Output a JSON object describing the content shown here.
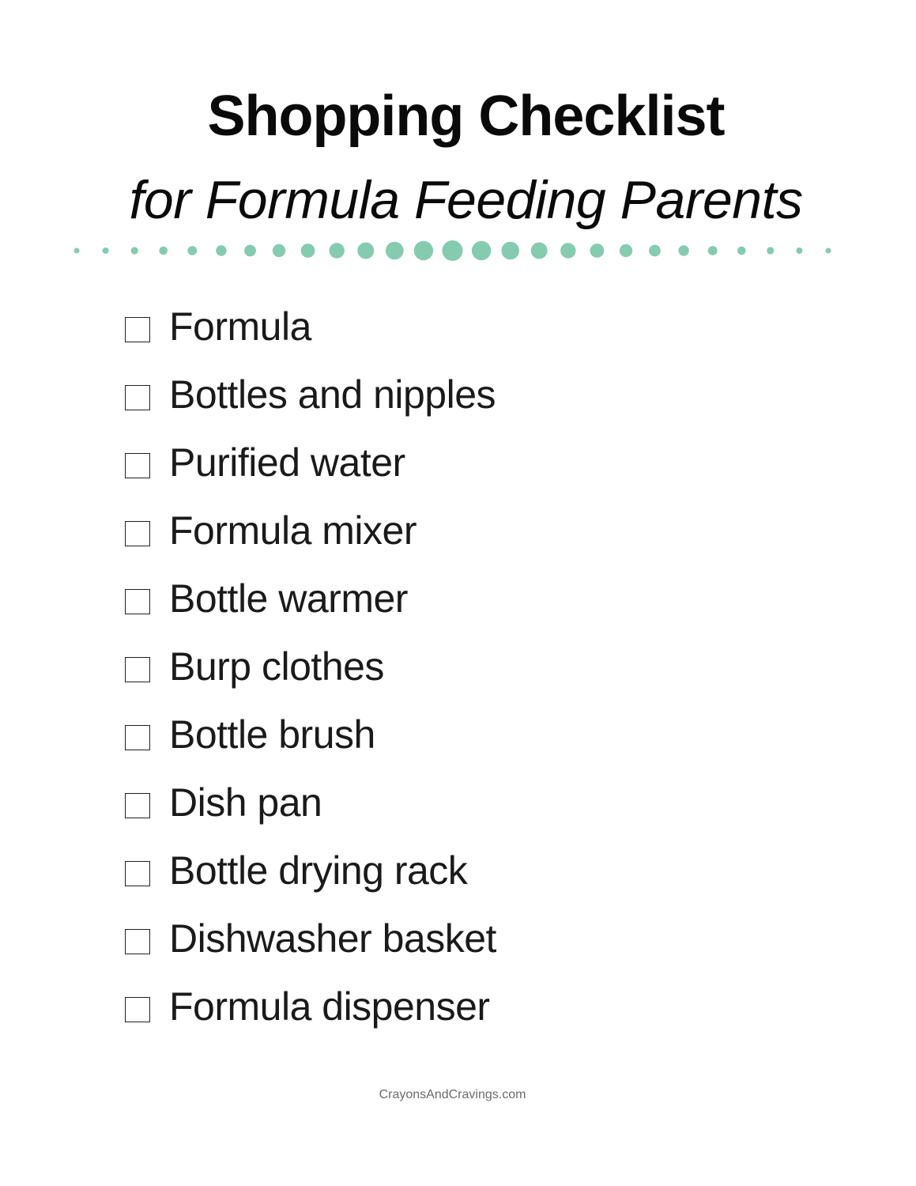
{
  "header": {
    "title": "Shopping Checklist",
    "subtitle": "for Formula Feeding Parents"
  },
  "divider": {
    "icon": "graduated-dot-divider",
    "dot_count": 27,
    "color": "#85cbb0"
  },
  "checklist": {
    "checkbox_icon": "empty-checkbox",
    "items": [
      {
        "label": "Formula",
        "checked": false
      },
      {
        "label": "Bottles and nipples",
        "checked": false
      },
      {
        "label": "Purified water",
        "checked": false
      },
      {
        "label": "Formula mixer",
        "checked": false
      },
      {
        "label": "Bottle warmer",
        "checked": false
      },
      {
        "label": "Burp clothes",
        "checked": false
      },
      {
        "label": "Bottle brush",
        "checked": false
      },
      {
        "label": "Dish pan",
        "checked": false
      },
      {
        "label": "Bottle drying rack",
        "checked": false
      },
      {
        "label": "Dishwasher basket",
        "checked": false
      },
      {
        "label": "Formula dispenser",
        "checked": false
      }
    ]
  },
  "footer": {
    "site": "CrayonsAndCravings.com"
  }
}
